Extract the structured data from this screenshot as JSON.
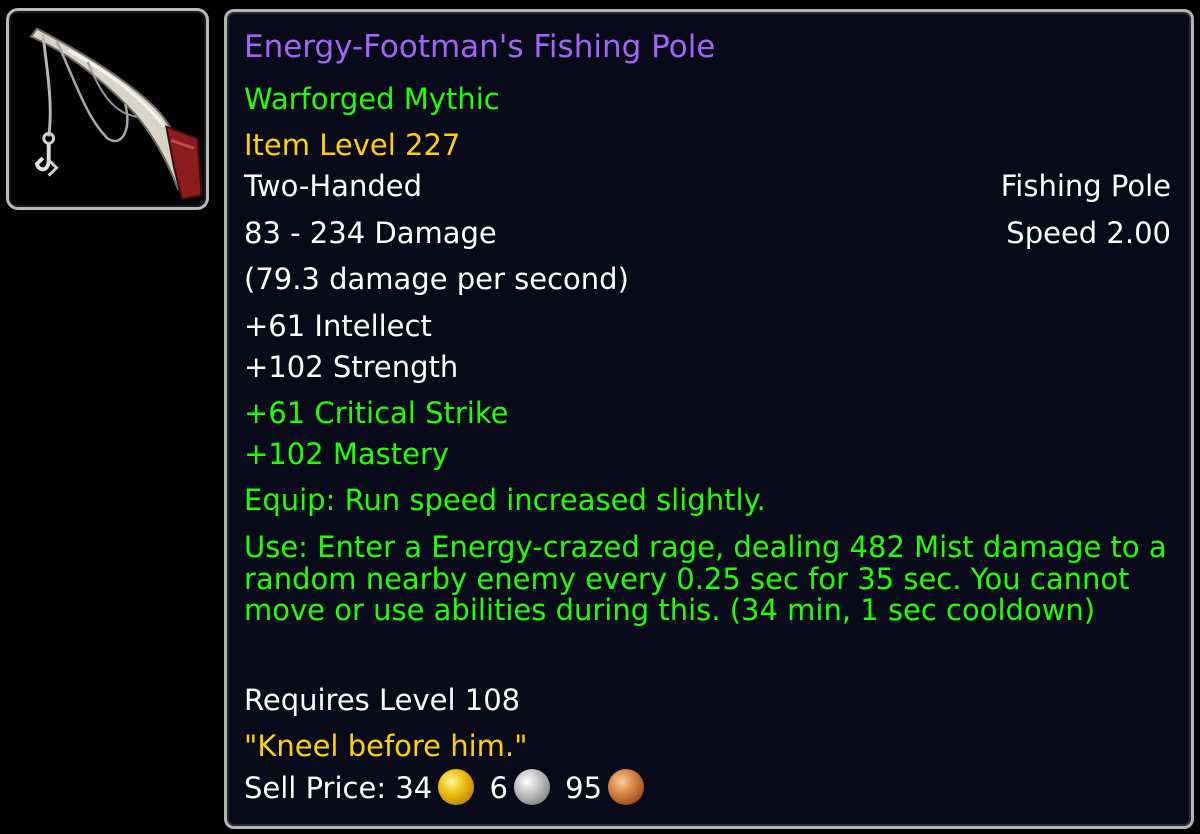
{
  "item": {
    "name": "Energy-Footman's Fishing Pole",
    "tier": "Warforged Mythic",
    "item_level": "Item Level 227",
    "slot": "Two-Handed",
    "type": "Fishing Pole",
    "damage": "83 - 234 Damage",
    "speed": "Speed 2.00",
    "dps": "(79.3 damage per second)",
    "stats": [
      "+61 Intellect",
      "+102 Strength"
    ],
    "secondary_stats": [
      "+61 Critical Strike",
      "+102 Mastery"
    ],
    "equip": "Equip: Run speed increased slightly.",
    "use": "Use: Enter a Energy-crazed rage, dealing 482 Mist damage to a random nearby enemy every 0.25 sec for 35 sec. You cannot move or use abilities during this. (34 min, 1 sec cooldown)",
    "requires": "Requires Level 108",
    "flavor": "\"Kneel before him.\"",
    "sell_label": "Sell Price:",
    "sell_gold": "34",
    "sell_silver": "6",
    "sell_copper": "95",
    "icon": "fishing-pole-icon"
  },
  "colors": {
    "epic_name": "#a464f5",
    "green": "#1eff00",
    "yellow": "#ffd100",
    "white": "#ffffff",
    "background": "#080a1a",
    "border": "#b3b3b3"
  }
}
